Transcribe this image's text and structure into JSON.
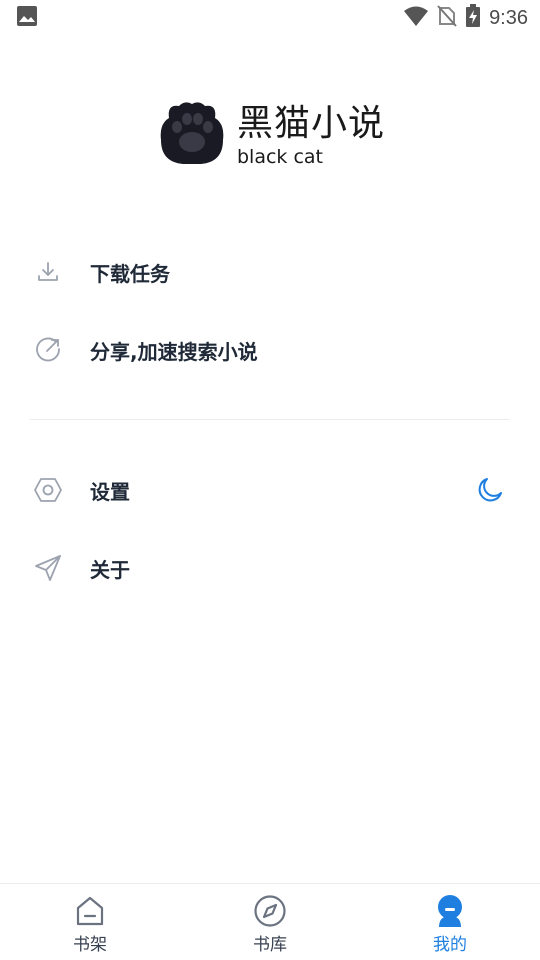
{
  "status_bar": {
    "time": "9:36",
    "icons": [
      "image-icon",
      "wifi-icon",
      "no-sim-icon",
      "battery-charging-icon"
    ]
  },
  "logo": {
    "title": "黑猫小说",
    "subtitle": "black cat",
    "icon": "paw-icon"
  },
  "menu": {
    "group1": [
      {
        "label": "下载任务",
        "icon": "download-icon"
      },
      {
        "label": "分享,加速搜索小说",
        "icon": "share-icon"
      }
    ],
    "group2": [
      {
        "label": "设置",
        "icon": "settings-icon",
        "trailing_icon": "moon-icon"
      },
      {
        "label": "关于",
        "icon": "send-icon"
      }
    ]
  },
  "bottom_nav": {
    "items": [
      {
        "label": "书架",
        "icon": "bookshelf-icon",
        "active": false
      },
      {
        "label": "书库",
        "icon": "compass-icon",
        "active": false
      },
      {
        "label": "我的",
        "icon": "profile-icon",
        "active": true
      }
    ]
  },
  "colors": {
    "accent": "#1e7fe0",
    "text": "#1f2937",
    "icon_gray": "#9ca3af",
    "logo_dark": "#1a1a24"
  }
}
